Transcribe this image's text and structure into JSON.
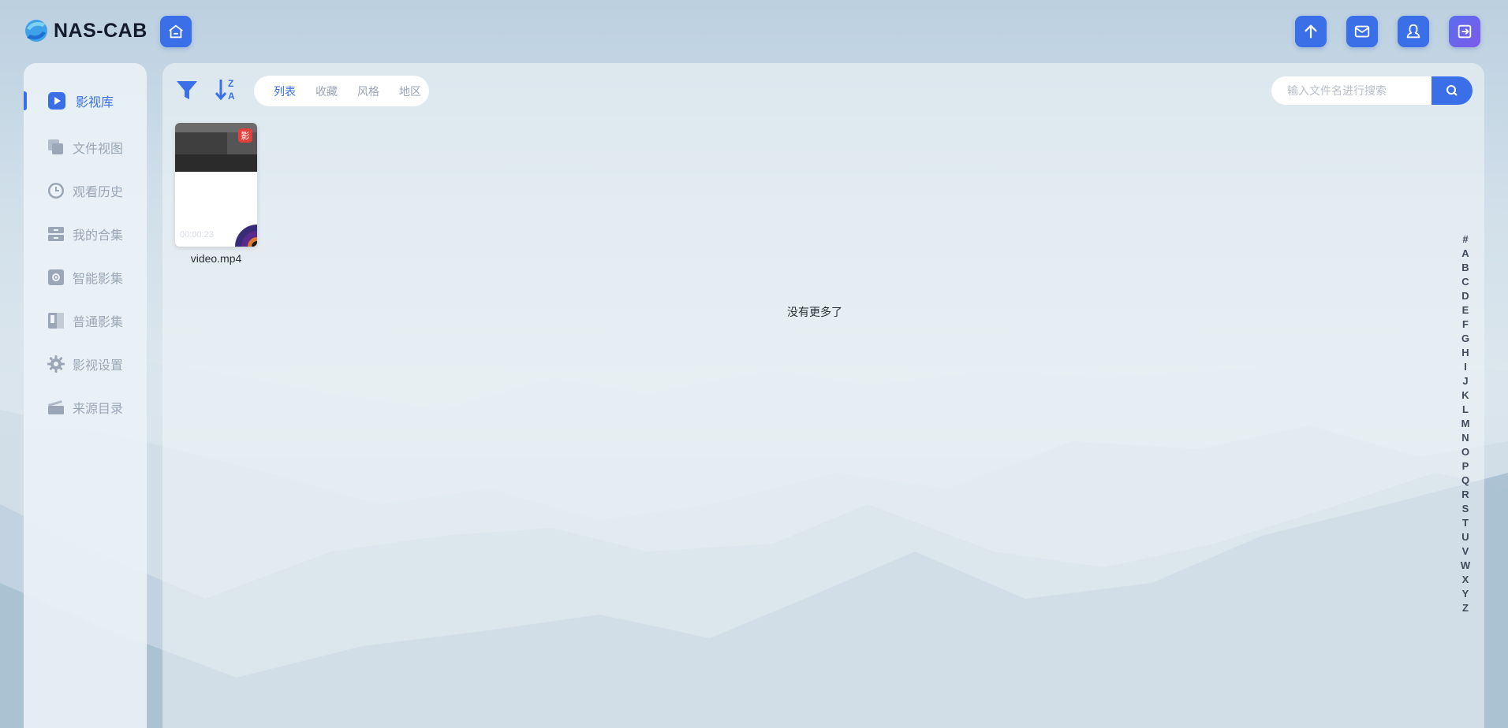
{
  "app": {
    "name": "NAS-CAB"
  },
  "header": {
    "buttons": [
      {
        "name": "home",
        "icon": "home-icon"
      },
      {
        "name": "upload",
        "icon": "arrow-up-icon"
      },
      {
        "name": "messages",
        "icon": "mail-icon"
      },
      {
        "name": "user",
        "icon": "user-icon"
      },
      {
        "name": "logout",
        "icon": "logout-icon"
      }
    ]
  },
  "sidebar": {
    "items": [
      {
        "label": "影视库",
        "icon": "play-icon",
        "active": true
      },
      {
        "label": "文件视图",
        "icon": "copy-icon",
        "active": false
      },
      {
        "label": "观看历史",
        "icon": "clock-icon",
        "active": false
      },
      {
        "label": "我的合集",
        "icon": "drawer-icon",
        "active": false
      },
      {
        "label": "智能影集",
        "icon": "gear-box-icon",
        "active": false
      },
      {
        "label": "普通影集",
        "icon": "book-icon",
        "active": false
      },
      {
        "label": "影视设置",
        "icon": "settings-icon",
        "active": false
      },
      {
        "label": "来源目录",
        "icon": "folder-icon",
        "active": false
      }
    ]
  },
  "toolbar": {
    "tabs": [
      {
        "label": "列表",
        "active": true
      },
      {
        "label": "收藏",
        "active": false
      },
      {
        "label": "风格",
        "active": false
      },
      {
        "label": "地区",
        "active": false
      }
    ],
    "search": {
      "placeholder": "输入文件名进行搜索",
      "value": ""
    }
  },
  "media": [
    {
      "title": "video.mp4",
      "duration": "00:00:23",
      "badge": "影"
    }
  ],
  "status": {
    "no_more": "没有更多了"
  },
  "alphabet": [
    "#",
    "A",
    "B",
    "C",
    "D",
    "E",
    "F",
    "G",
    "H",
    "I",
    "J",
    "K",
    "L",
    "M",
    "N",
    "O",
    "P",
    "Q",
    "R",
    "S",
    "T",
    "U",
    "V",
    "W",
    "X",
    "Y",
    "Z"
  ],
  "colors": {
    "accent": "#3a6fe8",
    "badge": "#e2413b",
    "muted": "#9ba6b7"
  }
}
